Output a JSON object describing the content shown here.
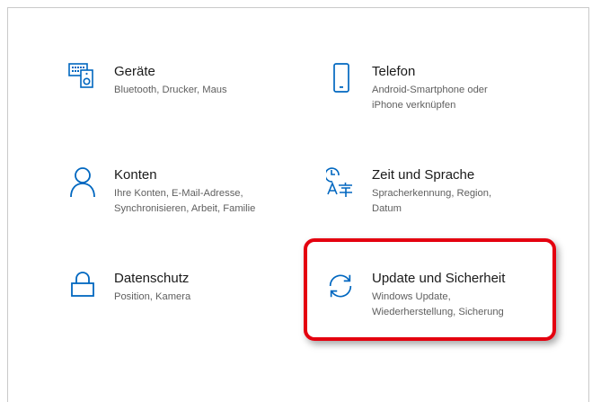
{
  "accent_color": "#0067c0",
  "highlight_color": "#e4000f",
  "tiles": [
    {
      "icon": "devices-icon",
      "title": "Geräte",
      "desc1": "Bluetooth, Drucker, Maus",
      "desc2": ""
    },
    {
      "icon": "phone-icon",
      "title": "Telefon",
      "desc1": "Android-Smartphone oder",
      "desc2": "iPhone verknüpfen"
    },
    {
      "icon": "person-icon",
      "title": "Konten",
      "desc1": "Ihre Konten, E-Mail-Adresse,",
      "desc2": "Synchronisieren, Arbeit, Familie"
    },
    {
      "icon": "time-language-icon",
      "title": "Zeit und Sprache",
      "desc1": "Spracherkennung, Region,",
      "desc2": "Datum"
    },
    {
      "icon": "lock-icon",
      "title": "Datenschutz",
      "desc1": "Position, Kamera",
      "desc2": ""
    },
    {
      "icon": "sync-icon",
      "title": "Update und Sicherheit",
      "desc1": "Windows Update,",
      "desc2": "Wiederherstellung, Sicherung"
    }
  ]
}
